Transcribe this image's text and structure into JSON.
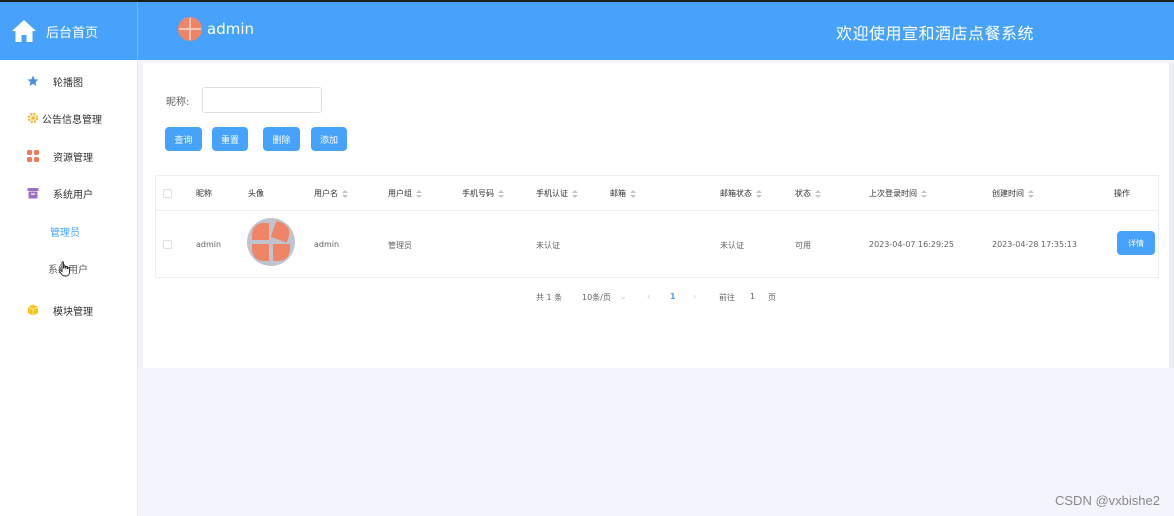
{
  "header": {
    "brand_label": "后台首页",
    "user_name": "admin",
    "welcome": "欢迎使用宣和酒店点餐系统"
  },
  "sidebar": {
    "items": [
      {
        "label": "轮播图",
        "icon": "star-icon"
      },
      {
        "label": "公告信息管理",
        "icon": "gear-icon"
      },
      {
        "label": "资源管理",
        "icon": "grid-icon"
      },
      {
        "label": "系统用户",
        "icon": "archive-icon"
      },
      {
        "label": "模块管理",
        "icon": "cube-icon"
      }
    ],
    "sub_items": [
      {
        "label": "管理员",
        "active": true
      },
      {
        "label": "系统用户",
        "active": false
      }
    ]
  },
  "search": {
    "label": "昵称:",
    "value": "",
    "placeholder": ""
  },
  "buttons": {
    "query": "查询",
    "reset": "重置",
    "delete": "删除",
    "add": "添加"
  },
  "table": {
    "headers": [
      "昵称",
      "头像",
      "用户名",
      "用户组",
      "手机号码",
      "手机认证",
      "邮箱",
      "邮箱状态",
      "状态",
      "上次登录时间",
      "创建时间",
      "操作"
    ],
    "rows": [
      {
        "nickname": "admin",
        "username": "admin",
        "group": "管理员",
        "phone": "",
        "phone_auth": "未认证",
        "email": "",
        "email_status": "未认证",
        "status": "可用",
        "last_login": "2023-04-07 16:29:25",
        "created": "2023-04-28 17:35:13",
        "action": "详情"
      }
    ]
  },
  "pagination": {
    "total": "共 1 条",
    "page_size": "10条/页",
    "current_page": "1",
    "goto_label": "前往",
    "goto_value": "1",
    "page_unit": "页"
  },
  "watermark": "CSDN @vxbishe2",
  "colors": {
    "primary": "#47a2fb",
    "avatar": "#ef8466",
    "avatar_bg": "#bfc4cf"
  }
}
